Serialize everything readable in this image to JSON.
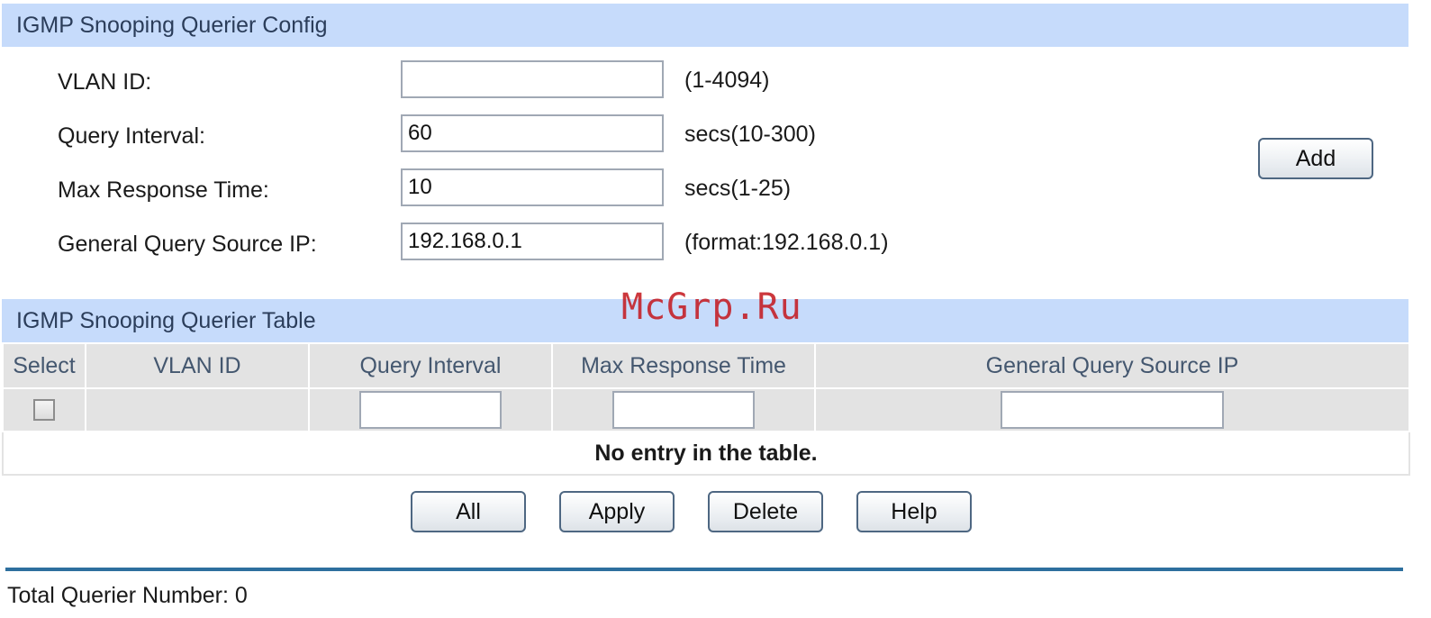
{
  "config": {
    "header": "IGMP Snooping Querier Config",
    "fields": [
      {
        "label": "VLAN ID:",
        "value": "",
        "hint": "(1-4094)"
      },
      {
        "label": "Query Interval:",
        "value": "60",
        "hint": "secs(10-300)"
      },
      {
        "label": "Max Response Time:",
        "value": "10",
        "hint": "secs(1-25)"
      },
      {
        "label": "General Query Source IP:",
        "value": "192.168.0.1",
        "hint": "(format:192.168.0.1)"
      }
    ],
    "add_label": "Add"
  },
  "table": {
    "header": "IGMP Snooping Querier Table",
    "columns": [
      "Select",
      "VLAN ID",
      "Query Interval",
      "Max Response Time",
      "General Query Source IP"
    ],
    "empty_message": "No entry in the table."
  },
  "actions": {
    "all_label": "All",
    "apply_label": "Apply",
    "delete_label": "Delete",
    "help_label": "Help"
  },
  "footer": {
    "total_text": "Total Querier Number: 0"
  },
  "watermark": "McGrp.Ru",
  "colors": {
    "header_bg": "#c6dbfb",
    "table_head_bg": "#e3e3e3",
    "divider": "#2e6f9e",
    "watermark": "#c4161c"
  }
}
